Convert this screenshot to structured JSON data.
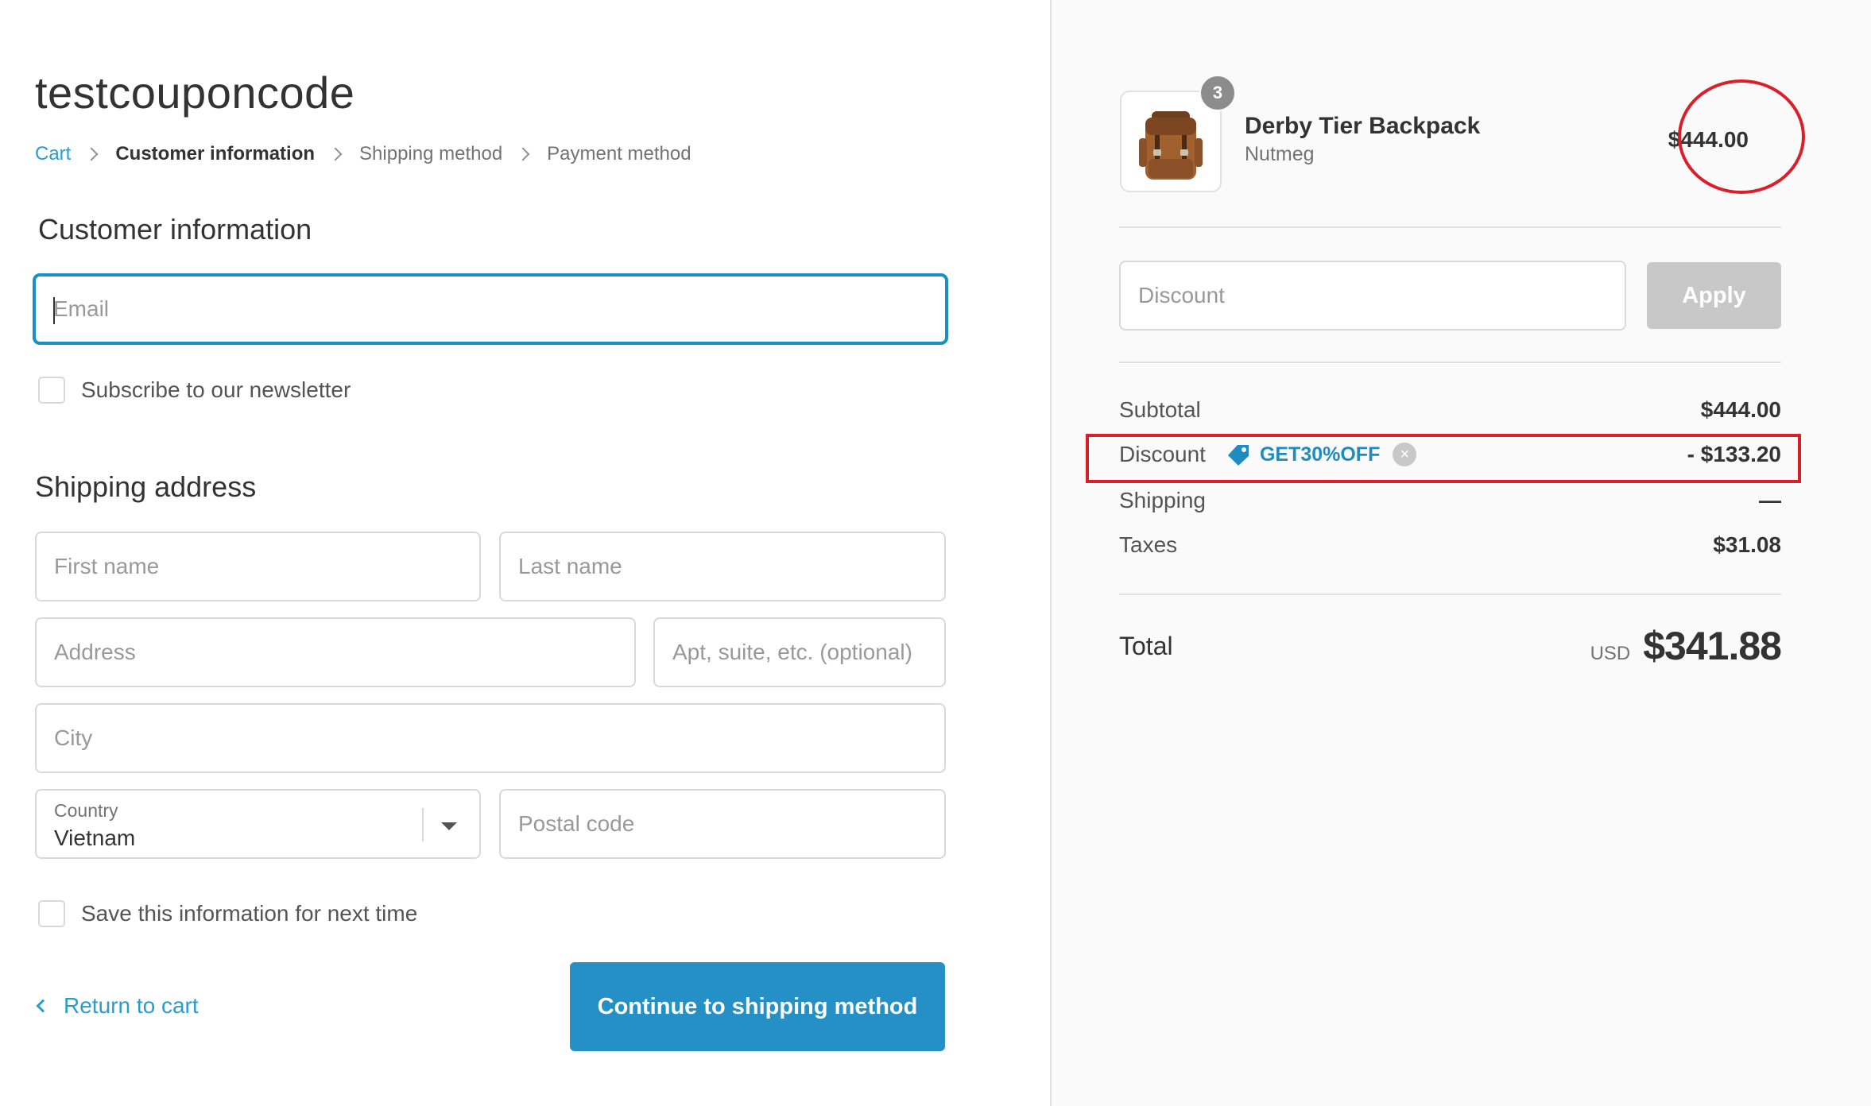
{
  "shop": {
    "title": "testcouponcode"
  },
  "breadcrumb": {
    "cart": "Cart",
    "customer_information": "Customer information",
    "shipping_method": "Shipping method",
    "payment_method": "Payment method"
  },
  "customer_info": {
    "heading": "Customer information",
    "email_placeholder": "Email",
    "newsletter_label": "Subscribe to our newsletter"
  },
  "shipping_address": {
    "heading": "Shipping address",
    "first_name_placeholder": "First name",
    "last_name_placeholder": "Last name",
    "address_placeholder": "Address",
    "apt_placeholder": "Apt, suite, etc. (optional)",
    "city_placeholder": "City",
    "country_label": "Country",
    "country_value": "Vietnam",
    "postal_placeholder": "Postal code",
    "save_info_label": "Save this information for next time"
  },
  "actions": {
    "return_label": "Return to cart",
    "continue_label": "Continue to shipping method"
  },
  "order": {
    "product": {
      "name": "Derby Tier Backpack",
      "variant": "Nutmeg",
      "quantity": "3",
      "price": "$444.00"
    },
    "discount_placeholder": "Discount",
    "apply_label": "Apply",
    "subtotal_label": "Subtotal",
    "subtotal_value": "$444.00",
    "discount_label": "Discount",
    "coupon_code": "GET30%OFF",
    "discount_value": "- $133.20",
    "shipping_label": "Shipping",
    "shipping_value": "—",
    "taxes_label": "Taxes",
    "taxes_value": "$31.08",
    "total_label": "Total",
    "currency": "USD",
    "total_value": "$341.88"
  },
  "colors": {
    "accent": "#2590c6",
    "link": "#2a9dcc",
    "annotation_red": "#d9202a",
    "sidebar_bg": "#fafafa"
  }
}
